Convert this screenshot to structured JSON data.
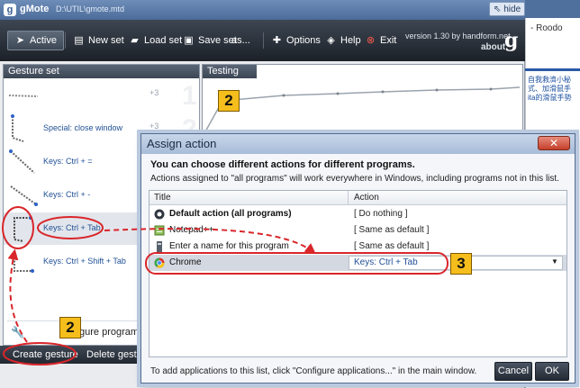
{
  "window": {
    "app_name": "gMote",
    "file_path": "D:\\UTIL\\gmote.mtd",
    "version_text": "version 1.30 by handform.net",
    "about_label": "about",
    "logo_letter": "g",
    "hide_label": "hide"
  },
  "toolbar": {
    "buttons": [
      {
        "label": "Active",
        "icon": "cursor-icon"
      },
      {
        "label": "New set",
        "icon": "new-document-icon"
      },
      {
        "label": "Load set",
        "icon": "folder-icon"
      },
      {
        "label": "Save set",
        "icon": "save-icon"
      },
      {
        "label": "as...",
        "icon": ""
      },
      {
        "label": "Options",
        "icon": "plus-icon"
      },
      {
        "label": "Help",
        "icon": "help-icon"
      },
      {
        "label": "Exit",
        "icon": "exit-icon"
      }
    ]
  },
  "gesture_set": {
    "title": "Gesture set",
    "items": [
      {
        "label": "",
        "mouse_button": "+3",
        "number": "1"
      },
      {
        "label": "Special: close window",
        "mouse_button": "+3",
        "number": "2"
      },
      {
        "label": "Keys: Ctrl + =",
        "mouse_button": "",
        "number": ""
      },
      {
        "label": "Keys: Ctrl + -",
        "mouse_button": "",
        "number": ""
      },
      {
        "label": "Keys: Ctrl + Tab",
        "mouse_button": "",
        "number": ""
      },
      {
        "label": "Keys: Ctrl + Shift + Tab",
        "mouse_button": "",
        "number": ""
      }
    ],
    "configure_label": "gure programs..."
  },
  "bottom_bar": {
    "create_label": "Create gesture",
    "delete_label": "Delete gesture"
  },
  "testing": {
    "title": "Testing"
  },
  "dialog": {
    "title": "Assign action",
    "close_glyph": "✕",
    "heading": "You can choose different actions for different programs.",
    "subheading": "Actions assigned to \"all programs\" will work everywhere in Windows, including programs not in this list.",
    "columns": {
      "title": "Title",
      "action": "Action"
    },
    "rows": [
      {
        "title": "Default action (all programs)",
        "action": "[ Do nothing ]",
        "icon": "gmote-icon"
      },
      {
        "title": "Notepad++",
        "action": "[ Same as default ]",
        "icon": "notepad-icon"
      },
      {
        "title": "Enter a name for this program",
        "action": "[ Same as default ]",
        "icon": "program-icon"
      },
      {
        "title": "Chrome",
        "action": "Keys: Ctrl + Tab",
        "icon": "chrome-icon"
      }
    ],
    "footer_text": "To add applications to this list, click \"Configure applications...\" in the main window.",
    "cancel_label": "Cancel",
    "ok_label": "OK"
  },
  "background_page": {
    "header_text": "- Roodo",
    "lines": [
      "自我救濟小秘",
      "式、加滑鼠手",
      "ita的滑鼠手勢"
    ]
  },
  "annotations": {
    "callout_testing": "2",
    "callout_bottom": "2",
    "callout_chrome": "3",
    "highlight_color": "#d9262b",
    "callout_color": "#f6be1c"
  }
}
